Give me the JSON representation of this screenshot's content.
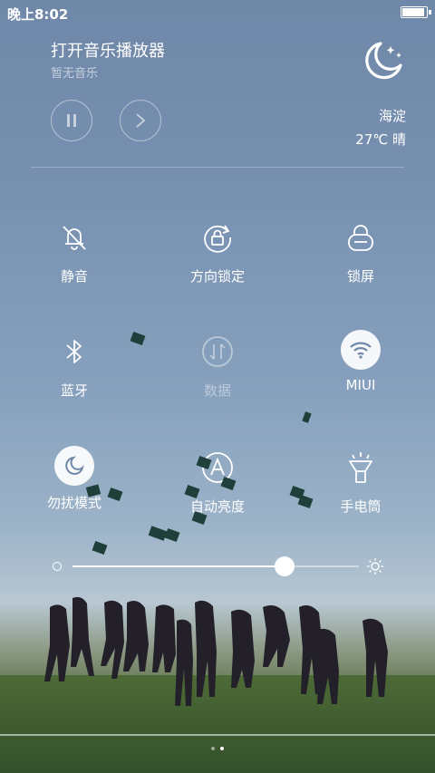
{
  "status": {
    "time": "晚上8:02",
    "battery_level": 0.95
  },
  "music": {
    "title": "打开音乐播放器",
    "subtitle": "暂无音乐",
    "pause_icon": "pause-icon",
    "next_icon": "chevron-right-icon"
  },
  "weather": {
    "icon": "moon-stars-icon",
    "city": "海淀",
    "temp_condition": "27℃  晴"
  },
  "toggles": [
    {
      "label": "静音",
      "icon": "bell-off-icon",
      "active": false,
      "enabled": true
    },
    {
      "label": "方向锁定",
      "icon": "rotation-lock-icon",
      "active": false,
      "enabled": true
    },
    {
      "label": "锁屏",
      "icon": "lock-icon",
      "active": false,
      "enabled": true
    },
    {
      "label": "蓝牙",
      "icon": "bluetooth-icon",
      "active": false,
      "enabled": true
    },
    {
      "label": "数据",
      "icon": "mobile-data-icon",
      "active": false,
      "enabled": false
    },
    {
      "label": "MIUI",
      "icon": "wifi-icon",
      "active": true,
      "enabled": true
    },
    {
      "label": "勿扰模式",
      "icon": "moon-icon",
      "active": true,
      "enabled": true
    },
    {
      "label": "自动亮度",
      "icon": "auto-brightness-icon",
      "active": false,
      "enabled": true
    },
    {
      "label": "手电筒",
      "icon": "flashlight-icon",
      "active": false,
      "enabled": true
    }
  ],
  "brightness": {
    "value": 0.74,
    "min_icon": "brightness-low-icon",
    "max_icon": "brightness-high-icon"
  },
  "pager": {
    "pages": 2,
    "current": 2
  },
  "colors": {
    "active_bg": "#ffffff",
    "active_fg": "#6f87a8"
  }
}
